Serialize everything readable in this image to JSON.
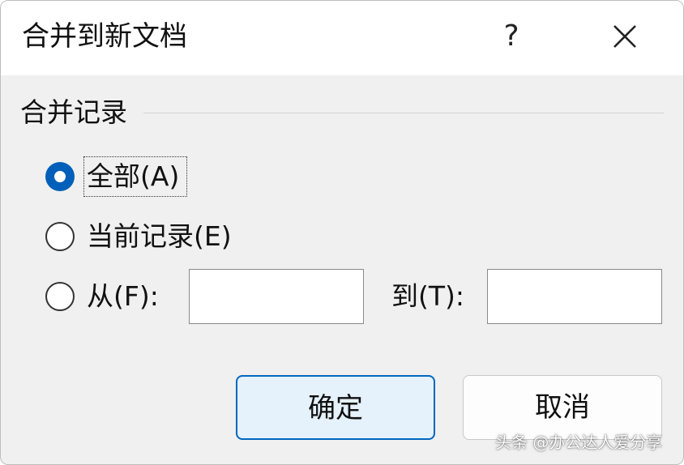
{
  "dialog": {
    "title": "合并到新文档",
    "help_label": "?"
  },
  "merge_records": {
    "group_label": "合并记录",
    "options": [
      {
        "label": "全部(A)",
        "checked": true
      },
      {
        "label": "当前记录(E)",
        "checked": false
      },
      {
        "label": "从(F):",
        "checked": false
      }
    ],
    "from_value": "",
    "to_label": "到(T):",
    "to_value": ""
  },
  "buttons": {
    "ok": "确定",
    "cancel": "取消"
  },
  "watermark": "头条 @办公达人爱分享",
  "colors": {
    "accent": "#005fb8",
    "ok_button_bg": "#e5f1fb",
    "dialog_bg": "#f0f0f0"
  }
}
